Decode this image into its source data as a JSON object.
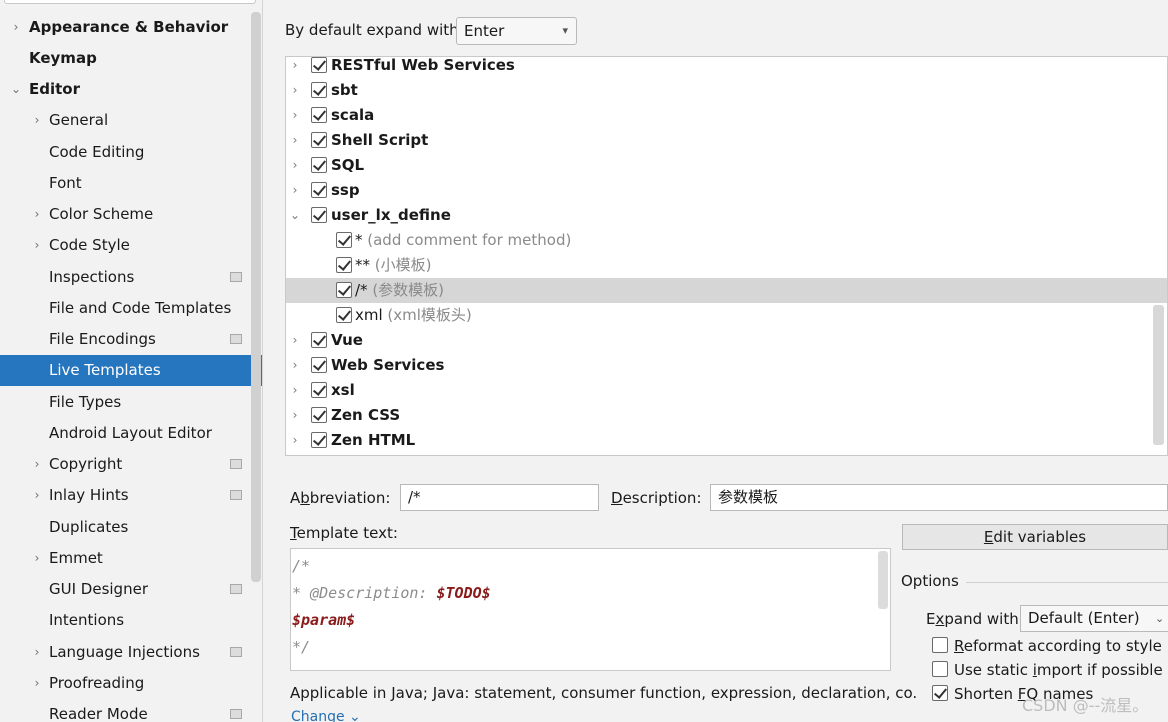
{
  "sidebar": {
    "items": [
      {
        "label": "Appearance & Behavior",
        "level": 0,
        "arrow": "›",
        "icon": "chevron-right-icon"
      },
      {
        "label": "Keymap",
        "level": 0,
        "arrow": "",
        "icon": ""
      },
      {
        "label": "Editor",
        "level": 0,
        "arrow": "⌄",
        "icon": "chevron-down-icon"
      },
      {
        "label": "General",
        "level": 1,
        "arrow": "›",
        "icon": "chevron-right-icon"
      },
      {
        "label": "Code Editing",
        "level": 1,
        "arrow": "",
        "icon": ""
      },
      {
        "label": "Font",
        "level": 1,
        "arrow": "",
        "icon": ""
      },
      {
        "label": "Color Scheme",
        "level": 1,
        "arrow": "›",
        "icon": "chevron-right-icon"
      },
      {
        "label": "Code Style",
        "level": 1,
        "arrow": "›",
        "icon": "chevron-right-icon"
      },
      {
        "label": "Inspections",
        "level": 1,
        "arrow": "",
        "icon": "",
        "project": true
      },
      {
        "label": "File and Code Templates",
        "level": 1,
        "arrow": "",
        "icon": ""
      },
      {
        "label": "File Encodings",
        "level": 1,
        "arrow": "",
        "icon": "",
        "project": true
      },
      {
        "label": "Live Templates",
        "level": 1,
        "arrow": "",
        "icon": "",
        "selected": true
      },
      {
        "label": "File Types",
        "level": 1,
        "arrow": "",
        "icon": ""
      },
      {
        "label": "Android Layout Editor",
        "level": 1,
        "arrow": "",
        "icon": ""
      },
      {
        "label": "Copyright",
        "level": 1,
        "arrow": "›",
        "icon": "chevron-right-icon",
        "project": true
      },
      {
        "label": "Inlay Hints",
        "level": 1,
        "arrow": "›",
        "icon": "chevron-right-icon",
        "project": true
      },
      {
        "label": "Duplicates",
        "level": 1,
        "arrow": "",
        "icon": ""
      },
      {
        "label": "Emmet",
        "level": 1,
        "arrow": "›",
        "icon": "chevron-right-icon"
      },
      {
        "label": "GUI Designer",
        "level": 1,
        "arrow": "",
        "icon": "",
        "project": true
      },
      {
        "label": "Intentions",
        "level": 1,
        "arrow": "",
        "icon": ""
      },
      {
        "label": "Language Injections",
        "level": 1,
        "arrow": "›",
        "icon": "chevron-right-icon",
        "project": true
      },
      {
        "label": "Proofreading",
        "level": 1,
        "arrow": "›",
        "icon": "chevron-right-icon"
      },
      {
        "label": "Reader Mode",
        "level": 1,
        "arrow": "",
        "icon": "",
        "project": true
      }
    ]
  },
  "expand_default": {
    "label": "By default expand with",
    "value": "Enter",
    "icon": "chevron-down-icon"
  },
  "tree": {
    "rows": [
      {
        "name": "RESTful Web Services",
        "desc": "",
        "level": 0,
        "arrow": "›",
        "checked": true
      },
      {
        "name": "sbt",
        "desc": "",
        "level": 0,
        "arrow": "›",
        "checked": true
      },
      {
        "name": "scala",
        "desc": "",
        "level": 0,
        "arrow": "›",
        "checked": true
      },
      {
        "name": "Shell Script",
        "desc": "",
        "level": 0,
        "arrow": "›",
        "checked": true
      },
      {
        "name": "SQL",
        "desc": "",
        "level": 0,
        "arrow": "›",
        "checked": true
      },
      {
        "name": "ssp",
        "desc": "",
        "level": 0,
        "arrow": "›",
        "checked": true
      },
      {
        "name": "user_lx_define",
        "desc": "",
        "level": 0,
        "arrow": "⌄",
        "checked": true
      },
      {
        "name": "*",
        "desc": " (add comment for method)",
        "level": 1,
        "arrow": "",
        "checked": true
      },
      {
        "name": "**",
        "desc": " (小模板)",
        "level": 1,
        "arrow": "",
        "checked": true
      },
      {
        "name": "/*",
        "desc": " (参数模板)",
        "level": 1,
        "arrow": "",
        "checked": true,
        "selected": true
      },
      {
        "name": "xml",
        "desc": " (xml模板头)",
        "level": 1,
        "arrow": "",
        "checked": true
      },
      {
        "name": "Vue",
        "desc": "",
        "level": 0,
        "arrow": "›",
        "checked": true
      },
      {
        "name": "Web Services",
        "desc": "",
        "level": 0,
        "arrow": "›",
        "checked": true
      },
      {
        "name": "xsl",
        "desc": "",
        "level": 0,
        "arrow": "›",
        "checked": true
      },
      {
        "name": "Zen CSS",
        "desc": "",
        "level": 0,
        "arrow": "›",
        "checked": true
      },
      {
        "name": "Zen HTML",
        "desc": "",
        "level": 0,
        "arrow": "›",
        "checked": true
      }
    ]
  },
  "abbreviation": {
    "label_pre": "A",
    "label_mnemonic": "b",
    "label_post": "breviation:",
    "value": "/*"
  },
  "description": {
    "label_mnemonic": "D",
    "label_post": "escription:",
    "value": "参数模板"
  },
  "template_text": {
    "label_mnemonic": "T",
    "label_post": "emplate text:",
    "lines": [
      {
        "parts": [
          {
            "text": "/*",
            "kind": "comment"
          }
        ]
      },
      {
        "parts": [
          {
            "text": "* @Description: ",
            "kind": "comment"
          },
          {
            "text": "$TODO$",
            "kind": "var"
          }
        ]
      },
      {
        "parts": [
          {
            "text": "$param$",
            "kind": "var"
          }
        ]
      },
      {
        "parts": [
          {
            "text": "*/",
            "kind": "comment"
          }
        ]
      }
    ]
  },
  "edit_variables": {
    "mnemonic": "E",
    "label_post": "dit variables"
  },
  "options": {
    "title": "Options",
    "expand_with": {
      "label_pre": "E",
      "label_mnemonic": "x",
      "label_post": "pand with",
      "value": "Default (Enter)",
      "icon": "chevron-down-icon"
    },
    "checkboxes": [
      {
        "pre": "",
        "mnemonic": "R",
        "post": "eformat according to style",
        "checked": false
      },
      {
        "pre": "Use static ",
        "mnemonic": "i",
        "post": "mport if possible",
        "checked": false
      },
      {
        "pre": "Shorten ",
        "mnemonic": "F",
        "post": "Q names",
        "checked": true
      }
    ]
  },
  "applicable": "Applicable in Java; Java: statement, consumer function, expression, declaration, co.",
  "change_link": "Change ⌄",
  "watermark": "CSDN @--流星。",
  "colors": {
    "selection": "#2675bf",
    "tree_selection": "#d6d6d6",
    "template_var": "#8b1a1a"
  }
}
